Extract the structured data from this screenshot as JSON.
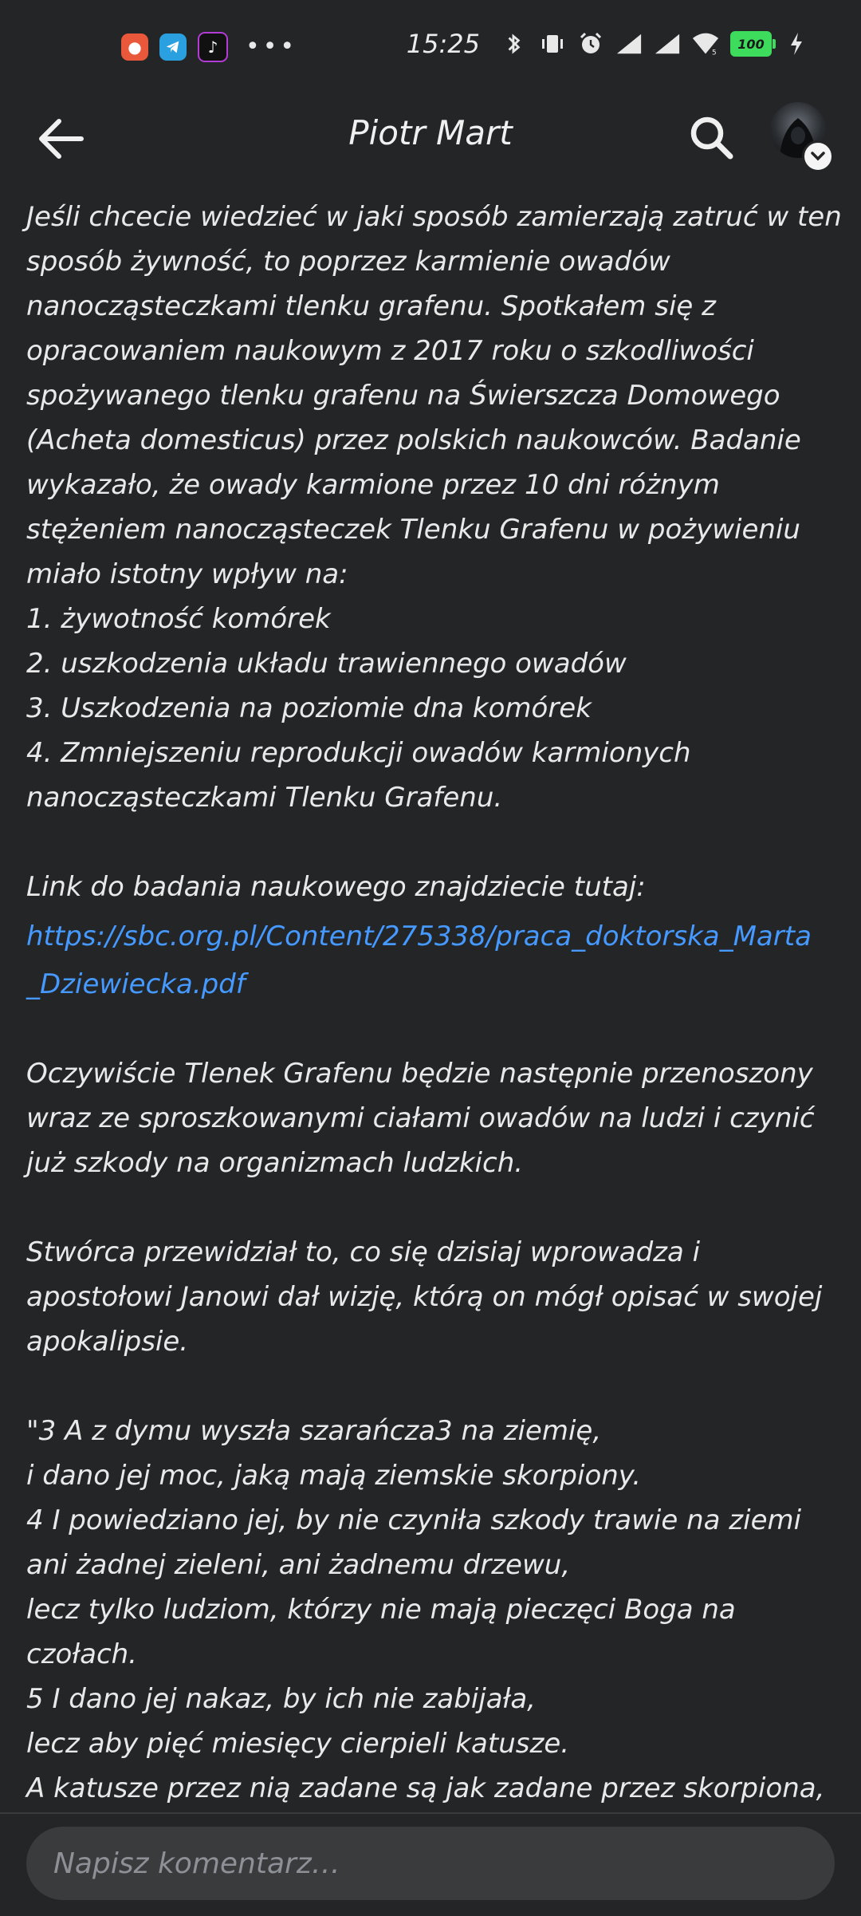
{
  "status_bar": {
    "time": "15:25",
    "more": "•••",
    "battery": "100",
    "app_icons": [
      "notification-app-icon",
      "telegram-icon",
      "tiktok-icon"
    ]
  },
  "header": {
    "title": "Piotr Mart"
  },
  "post": {
    "intro_lines": [
      "Jeśli chcecie wiedzieć w jaki sposób zamierzają zatruć w ten",
      "sposób żywność, to poprzez karmienie owadów",
      "nanocząsteczkami tlenku grafenu. Spotkałem się z",
      "opracowaniem naukowym z 2017 roku o szkodliwości",
      "spożywanego tlenku grafenu na Świerszcza Domowego",
      "(Acheta domesticus) przez polskich naukowców. Badanie",
      "wykazało, że owady karmione przez 10 dni różnym",
      "stężeniem nanocząsteczek Tlenku Grafenu w pożywieniu",
      "miało istotny wpływ na:",
      "1. żywotność komórek",
      "2. uszkodzenia układu trawiennego owadów",
      "3. Uszkodzenia na poziomie dna komórek",
      "4. Zmniejszeniu reprodukcji owadów karmionych",
      "nanocząsteczkami Tlenku Grafenu."
    ],
    "link_intro": "Link do badania naukowego znajdziecie tutaj:",
    "link_line1": "https://sbc.org.pl/Content/275338/praca_doktorska_Marta",
    "link_line2": "_Dziewiecka.pdf",
    "para2_lines": [
      "Oczywiście Tlenek Grafenu będzie następnie przenoszony",
      "wraz ze sproszkowanymi ciałami owadów na ludzi i czynić",
      "już szkody na organizmach ludzkich."
    ],
    "para3_lines": [
      "Stwórca przewidział to, co się dzisiaj wprowadza i",
      "apostołowi Janowi dał wizję, którą on mógł opisać w swojej",
      "apokalipsie."
    ],
    "quote_lines": [
      "\"3 A z dymu wyszła szarańcza3 na ziemię,",
      "i dano jej moc, jaką mają ziemskie skorpiony.",
      "4 I powiedziano jej, by nie czyniła szkody trawie na ziemi",
      "ani żadnej zieleni, ani żadnemu drzewu,",
      "lecz tylko ludziom, którzy nie mają pieczęci Boga na",
      "czołach.",
      "5 I dano jej nakaz, by ich nie zabijała,",
      "lecz aby pięć miesięcy cierpieli katusze.",
      "A katusze przez nią zadane są jak zadane przez skorpiona,"
    ]
  },
  "comment": {
    "placeholder": "Napisz komentarz…"
  },
  "colors": {
    "background": "#242526",
    "text": "#e9e9ea",
    "link": "#4599ff",
    "input_bg": "#3a3b3c"
  }
}
